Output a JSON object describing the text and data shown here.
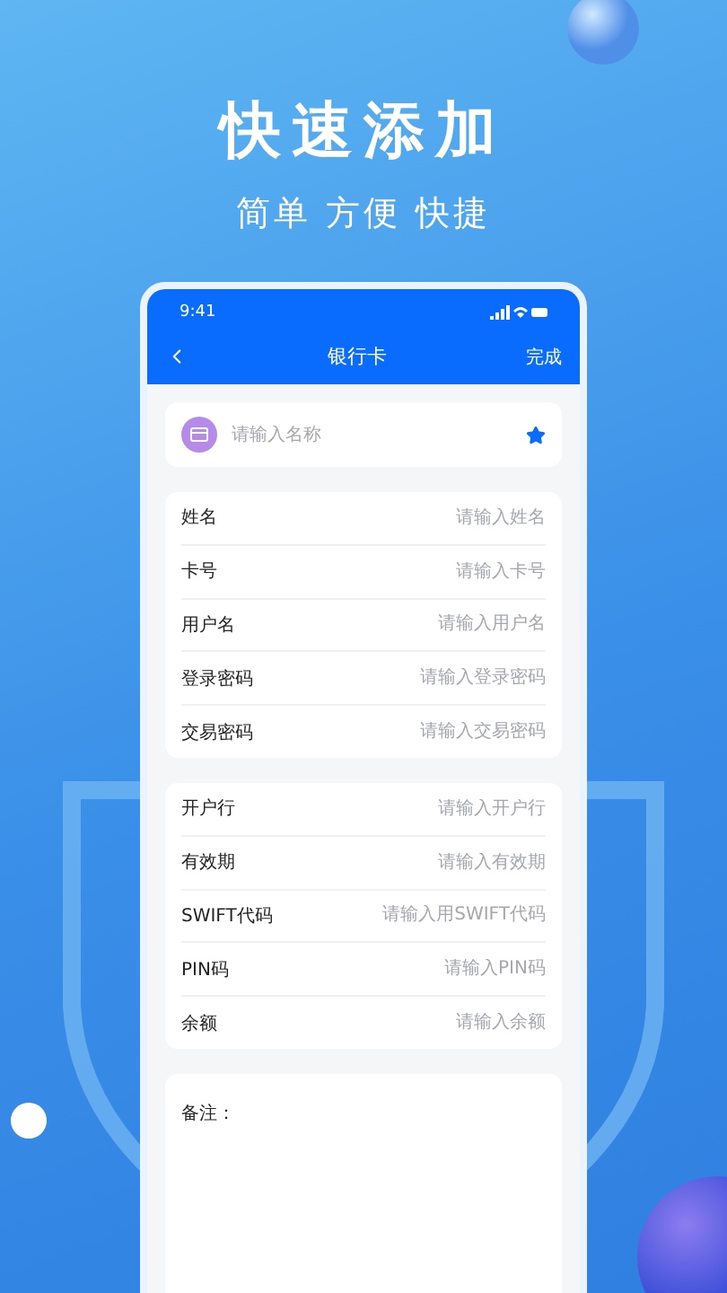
{
  "headline": "快速添加",
  "tagline": "简单 方便 快捷",
  "phone": {
    "status_bar": {
      "time": "9:41"
    },
    "nav": {
      "title": "银行卡",
      "action": "完成"
    },
    "name_field": {
      "placeholder": "请输入名称",
      "starred": true
    },
    "groups": [
      {
        "fields": [
          {
            "label": "姓名",
            "placeholder": "请输入姓名"
          },
          {
            "label": "卡号",
            "placeholder": "请输入卡号"
          },
          {
            "label": "用户名",
            "placeholder": "请输入用户名"
          },
          {
            "label": "登录密码",
            "placeholder": "请输入登录密码"
          },
          {
            "label": "交易密码",
            "placeholder": "请输入交易密码"
          }
        ]
      },
      {
        "fields": [
          {
            "label": "开户行",
            "placeholder": "请输入开户行"
          },
          {
            "label": "有效期",
            "placeholder": "请输入有效期"
          },
          {
            "label": "SWIFT代码",
            "placeholder": "请输入用SWIFT代码"
          },
          {
            "label": "PIN码",
            "placeholder": "请输入PIN码"
          },
          {
            "label": "余额",
            "placeholder": "请输入余额"
          }
        ]
      }
    ],
    "note": {
      "label": "备注："
    }
  }
}
